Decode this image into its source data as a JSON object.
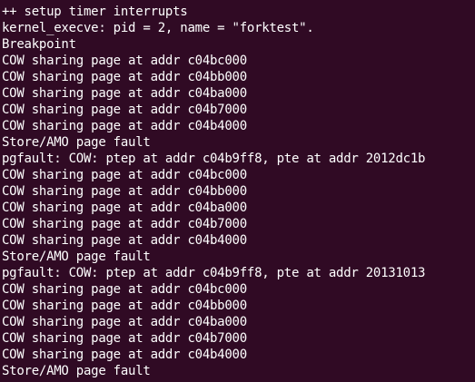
{
  "terminal": {
    "background": "#300a24",
    "foreground": "#ffffff",
    "lines": [
      "++ setup timer interrupts",
      "kernel_execve: pid = 2, name = \"forktest\".",
      "Breakpoint",
      "COW sharing page at addr c04bc000",
      "COW sharing page at addr c04bb000",
      "COW sharing page at addr c04ba000",
      "COW sharing page at addr c04b7000",
      "COW sharing page at addr c04b4000",
      "Store/AMO page fault",
      "pgfault: COW: ptep at addr c04b9ff8, pte at addr 2012dc1b",
      "COW sharing page at addr c04bc000",
      "COW sharing page at addr c04bb000",
      "COW sharing page at addr c04ba000",
      "COW sharing page at addr c04b7000",
      "COW sharing page at addr c04b4000",
      "Store/AMO page fault",
      "pgfault: COW: ptep at addr c04b9ff8, pte at addr 20131013",
      "COW sharing page at addr c04bc000",
      "COW sharing page at addr c04bb000",
      "COW sharing page at addr c04ba000",
      "COW sharing page at addr c04b7000",
      "COW sharing page at addr c04b4000",
      "Store/AMO page fault"
    ]
  }
}
